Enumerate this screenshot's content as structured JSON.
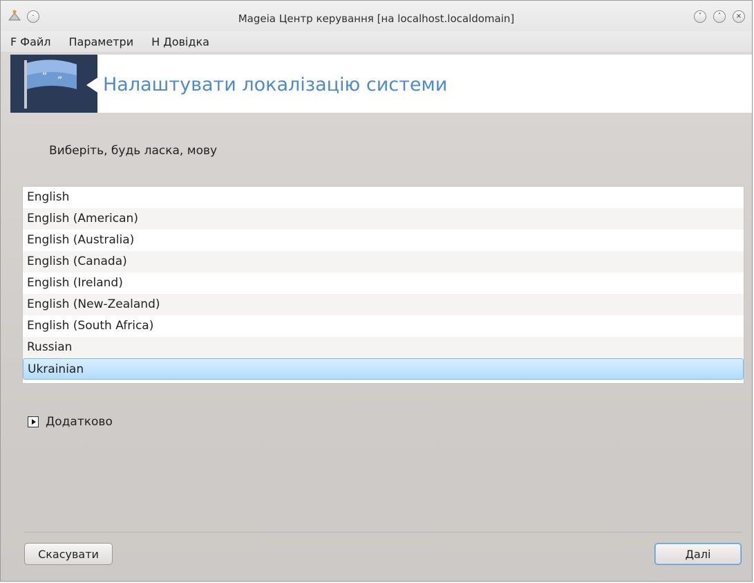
{
  "window": {
    "title": "Mageia Центр керування  [на localhost.localdomain]"
  },
  "menu": {
    "file": "F Файл",
    "options": "Параметри",
    "help": "H Довідка"
  },
  "banner": {
    "title": "Налаштувати локалізацію системи"
  },
  "prompt": "Виберіть, будь ласка, мову",
  "languages": [
    "English",
    "English (American)",
    "English (Australia)",
    "English (Canada)",
    "English (Ireland)",
    "English (New-Zealand)",
    "English (South Africa)",
    "Russian",
    "Ukrainian"
  ],
  "selected_language": "Ukrainian",
  "advanced_label": "Додатково",
  "buttons": {
    "cancel": "Скасувати",
    "next": "Далі"
  },
  "icons": {
    "app": "mageia-app-icon",
    "sticky": "sticky-icon",
    "minimize": "minimize-icon",
    "maximize": "maximize-icon",
    "close": "close-icon",
    "banner": "locale-flag-icon",
    "expander": "expander-arrow-icon"
  },
  "colors": {
    "banner_title": "#4a8bd1",
    "banner_logo_bg": "#2b3a57",
    "selection": "#b3dcfb"
  }
}
